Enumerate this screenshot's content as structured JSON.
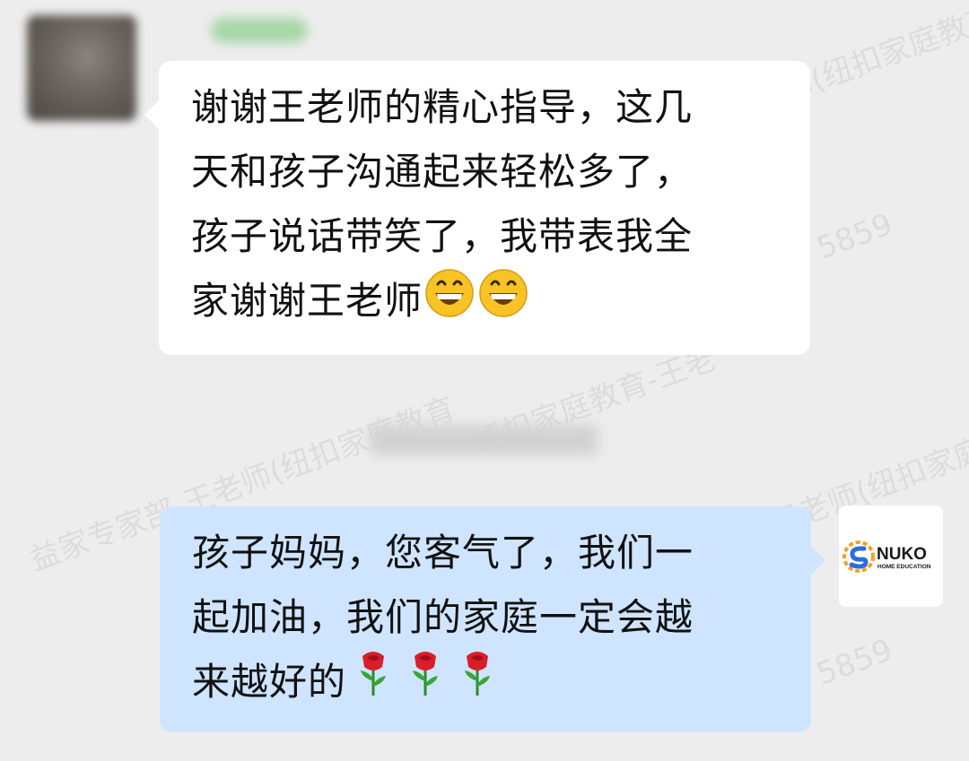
{
  "watermarks": [
    "益家专家部-王老师(纽扣家庭教育",
    "王老师(纽扣家庭教育",
    "纽扣家庭教育-王老",
    "王老师(纽扣家庭教",
    "5859",
    "5859"
  ],
  "messages": [
    {
      "sender": "received",
      "lines": [
        "谢谢王老师的精心指导，这几",
        "天和孩子沟通起来轻松多了，",
        "孩子说话带笑了，我带表我全",
        "家谢谢王老师"
      ],
      "emoji": [
        "grinning-face-emoji",
        "grinning-face-emoji"
      ]
    },
    {
      "sender": "sent",
      "lines": [
        "孩子妈妈，您客气了，我们一",
        "起加油，我们的家庭一定会越",
        "来越好的"
      ],
      "emoji": [
        "rose-emoji",
        "rose-emoji",
        "rose-emoji"
      ]
    }
  ],
  "avatar_right": {
    "brand": "NUKO",
    "tagline": "HOME EDUCATION",
    "accent_colors": [
      "#f4a21d",
      "#2a6fdb"
    ]
  },
  "colors": {
    "background": "#ededed",
    "received_bubble": "#ffffff",
    "sent_bubble": "#cfe5ff",
    "nickname_blur": "#9bd39b"
  }
}
